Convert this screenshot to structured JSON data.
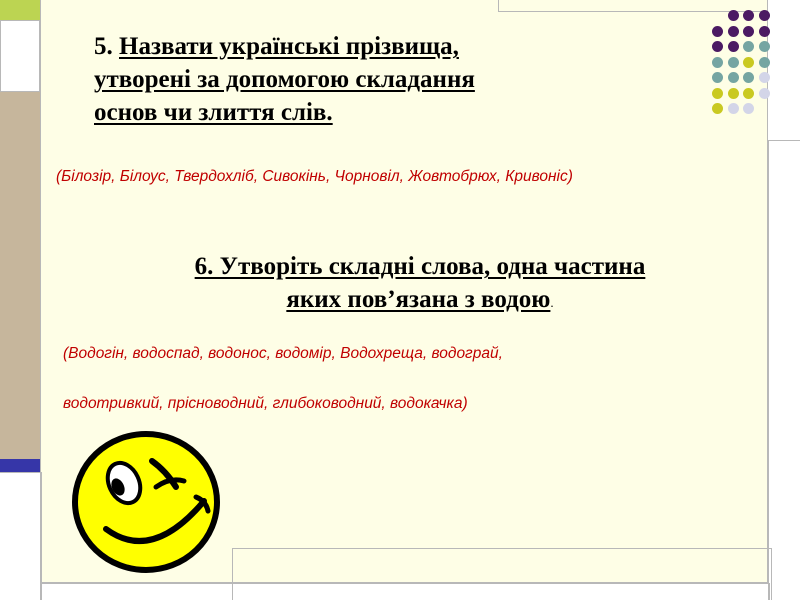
{
  "colors": {
    "panel_background": "#fefee6",
    "lime_block": "#bcd452",
    "tan_block": "#c6b69c",
    "navy_bar": "#3636a8",
    "answer_text": "#c00000",
    "dot_purple": "#4b1a63",
    "dot_teal": "#75a5a2",
    "dot_yellow": "#c9c921",
    "dot_lavender": "#d3d5e8",
    "smiley_yellow": "#ffff00"
  },
  "task5": {
    "heading_number": "5.",
    "heading_line1": "Назвати українські прізвища,",
    "heading_line2": "утворені за допомогою складання",
    "heading_line3": "основ чи злиття слів.",
    "answer": "(Білозір, Білоус, Твердохліб, Сивокінь, Чорновіл, Жовтобрюх, Кривоніс)"
  },
  "task6": {
    "heading_line1": "6. Утворіть складні слова, одна частина",
    "heading_line2": "яких пов’язана з водою",
    "heading_trailing_dot": ".",
    "answer_line1": "(Водогін, водоспад, водонос, водомір, Водохреща, водограй,",
    "answer_line2": "водотривкий, прісноводний, глибоководний, водокачка)"
  },
  "decoration": {
    "smiley": "winking-smiley-face-icon",
    "dot_grid": "dot-grid-pattern"
  }
}
